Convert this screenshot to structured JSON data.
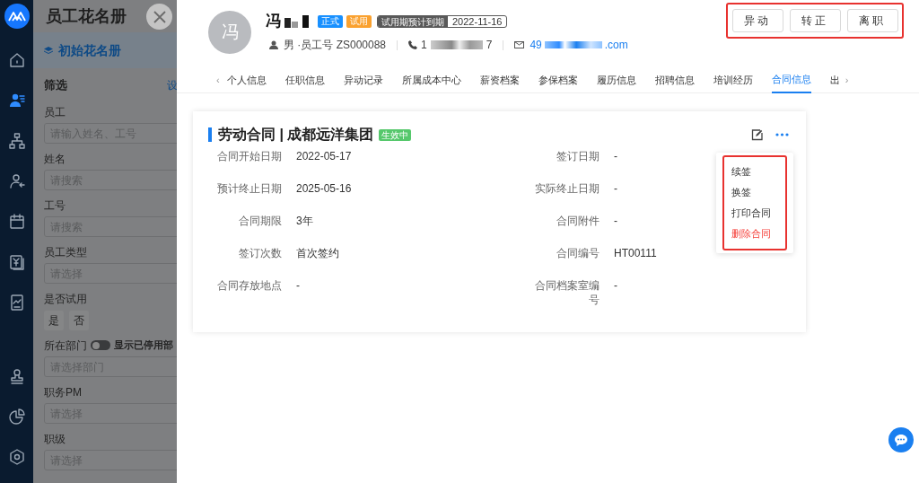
{
  "rail": [
    {
      "kind": "logo"
    },
    {
      "kind": "home",
      "selected": false
    },
    {
      "kind": "people",
      "selected": true
    },
    {
      "kind": "org",
      "selected": false
    },
    {
      "kind": "leave",
      "selected": false
    },
    {
      "kind": "calendar",
      "selected": false
    },
    {
      "kind": "salary",
      "selected": false
    },
    {
      "kind": "report",
      "selected": false
    },
    {
      "kind": "stamp",
      "selected": false
    },
    {
      "kind": "pie",
      "selected": false
    },
    {
      "kind": "settings",
      "selected": false
    }
  ],
  "filter_panel": {
    "title": "员工花名册",
    "roster": "初始花名册",
    "section": "筛选",
    "section_action": "设",
    "fields": [
      {
        "kind": "search",
        "label": "员工",
        "placeholder": "请输入姓名、工号"
      },
      {
        "kind": "search",
        "label": "姓名",
        "placeholder": "请搜索"
      },
      {
        "kind": "search",
        "label": "工号",
        "placeholder": "请搜索"
      },
      {
        "kind": "select",
        "label": "员工类型",
        "placeholder": "请选择"
      },
      {
        "kind": "choice",
        "label": "是否试用",
        "options": [
          "是",
          "否"
        ]
      },
      {
        "kind": "toggle_select",
        "label": "所在部门",
        "toggle_label": "显示已停用部",
        "on": false,
        "placeholder": "请选择部门"
      },
      {
        "kind": "select",
        "label": "职务PM",
        "placeholder": "请选择"
      },
      {
        "kind": "select",
        "label": "职级",
        "placeholder": "请选择"
      }
    ]
  },
  "employee": {
    "avatar": "冯",
    "name": "冯",
    "tags": [
      {
        "kind": "formal",
        "text": "正式"
      },
      {
        "kind": "trial",
        "text": "试用"
      }
    ],
    "probation": {
      "label": "试用期预计到期",
      "date": "2022-11-16"
    },
    "info": "男 ·员工号 ZS000088",
    "phone_start": "1",
    "phone_end": "7",
    "email_start": "49",
    "email_end": ".com"
  },
  "actions": [
    "异动",
    "转正",
    "离职"
  ],
  "tab_scroll": {
    "prev": "‹",
    "next": "›"
  },
  "tabs": [
    {
      "label": "个人信息",
      "selected": false
    },
    {
      "label": "任职信息",
      "selected": false
    },
    {
      "label": "异动记录",
      "selected": false
    },
    {
      "label": "所属成本中心",
      "selected": false
    },
    {
      "label": "薪资档案",
      "selected": false
    },
    {
      "label": "参保档案",
      "selected": false
    },
    {
      "label": "履历信息",
      "selected": false
    },
    {
      "label": "招聘信息",
      "selected": false
    },
    {
      "label": "培训经历",
      "selected": false
    },
    {
      "label": "合同信息",
      "selected": true
    },
    {
      "label": "出",
      "selected": false
    }
  ],
  "contract": {
    "title": "劳动合同 | 成都远洋集团",
    "status": "生效中",
    "fields": [
      {
        "label": "合同开始日期",
        "value": "2022-05-17"
      },
      {
        "label": "签订日期",
        "value": "-"
      },
      {
        "label": "预计终止日期",
        "value": "2025-05-16"
      },
      {
        "label": "实际终止日期",
        "value": "-"
      },
      {
        "label": "合同期限",
        "value": "3年"
      },
      {
        "label": "合同附件",
        "value": "-"
      },
      {
        "label": "签订次数",
        "value": "首次签约"
      },
      {
        "label": "合同编号",
        "value": "HT00111"
      },
      {
        "label": "合同存放地点",
        "value": "-"
      },
      {
        "label": "合同档案室编号",
        "value": "-"
      }
    ]
  },
  "menu": [
    {
      "label": "续签",
      "kind": "normal"
    },
    {
      "label": "换签",
      "kind": "normal"
    },
    {
      "label": "打印合同",
      "kind": "normal"
    },
    {
      "label": "删除合同",
      "kind": "danger"
    }
  ]
}
